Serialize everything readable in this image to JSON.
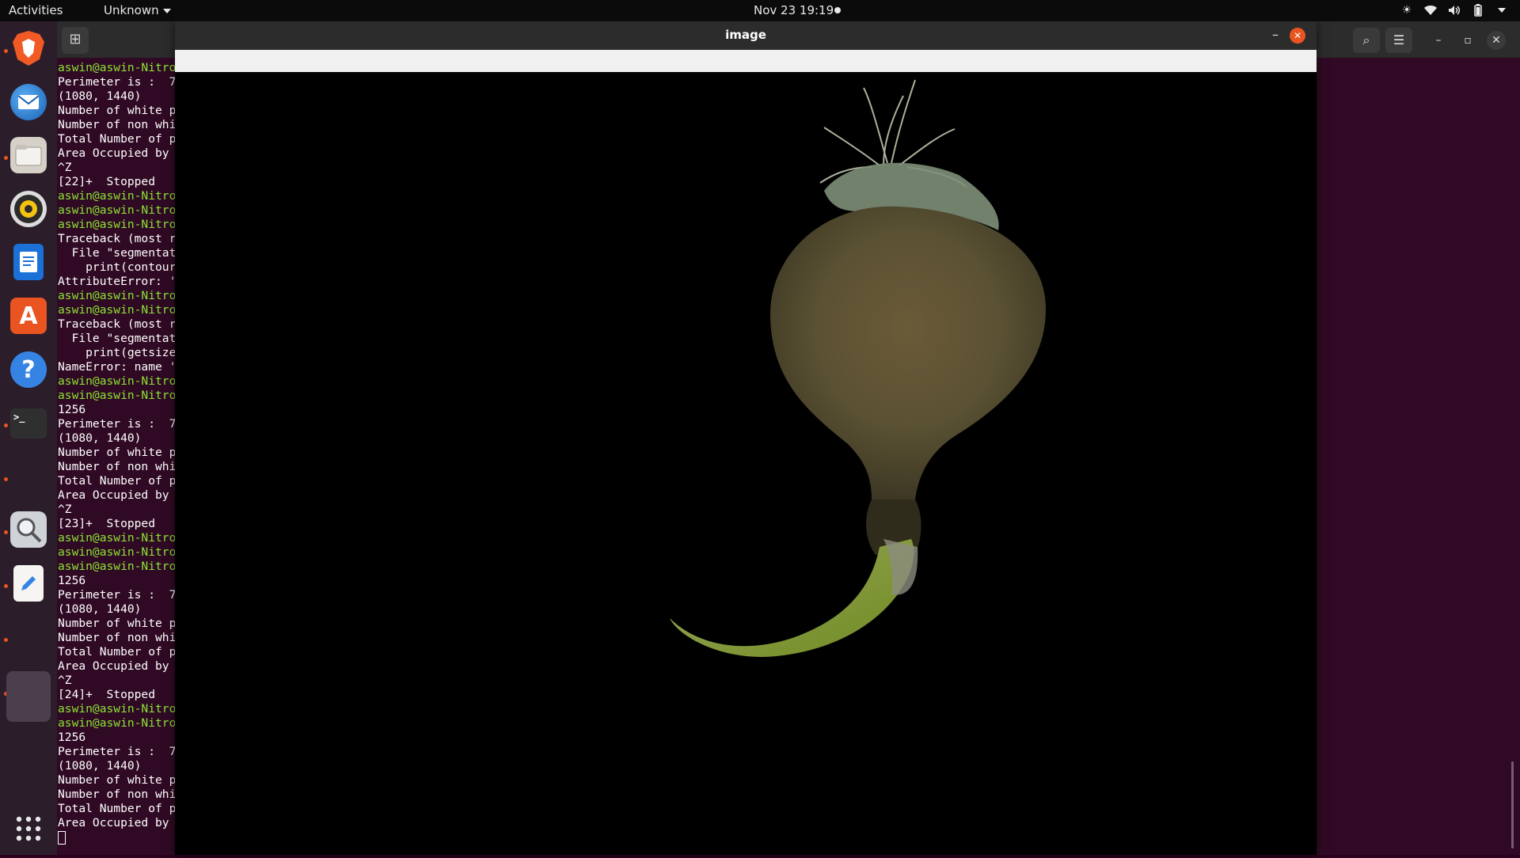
{
  "topbar": {
    "activities": "Activities",
    "app_menu": "Unknown",
    "clock": "Nov 23  19:19"
  },
  "dock": {
    "items": [
      {
        "name": "Brave",
        "icon": "brave-browser-icon"
      },
      {
        "name": "Thunderbird",
        "icon": "thunderbird-mail-icon"
      },
      {
        "name": "Files",
        "icon": "files-folder-icon"
      },
      {
        "name": "Rhythmbox",
        "icon": "rhythmbox-music-icon"
      },
      {
        "name": "LibreOffice Writer",
        "icon": "writer-document-icon"
      },
      {
        "name": "Ubuntu Software",
        "icon": "software-store-icon"
      },
      {
        "name": "Help",
        "icon": "help-icon"
      },
      {
        "name": "Terminal",
        "icon": "terminal-icon"
      },
      {
        "name": "Image Viewer",
        "icon": "magnifier-icon"
      },
      {
        "name": "Text Editor",
        "icon": "text-editor-icon"
      },
      {
        "name": "Image Window",
        "icon": "window-icon"
      }
    ],
    "show_apps_icon": "grid-icon"
  },
  "terminal": {
    "lines": [
      {
        "t": "aswin@aswin-Nitro",
        "p": true
      },
      {
        "t": "Perimeter is :  7",
        "p": false
      },
      {
        "t": "(1080, 1440)",
        "p": false
      },
      {
        "t": "Number of white p",
        "p": false
      },
      {
        "t": "Number of non whi",
        "p": false
      },
      {
        "t": "Total Number of p",
        "p": false
      },
      {
        "t": "Area Occupied by ",
        "p": false
      },
      {
        "t": "^Z",
        "p": false
      },
      {
        "t": "[22]+  Stopped",
        "p": false
      },
      {
        "t": "aswin@aswin-Nitro",
        "p": true
      },
      {
        "t": "aswin@aswin-Nitro",
        "p": true
      },
      {
        "t": "aswin@aswin-Nitro",
        "p": true
      },
      {
        "t": "Traceback (most r",
        "p": false
      },
      {
        "t": "  File \"segmentat",
        "p": false
      },
      {
        "t": "    print(contour",
        "p": false
      },
      {
        "t": "AttributeError: '",
        "p": false
      },
      {
        "t": "aswin@aswin-Nitro",
        "p": true
      },
      {
        "t": "aswin@aswin-Nitro",
        "p": true
      },
      {
        "t": "Traceback (most r",
        "p": false
      },
      {
        "t": "  File \"segmentat",
        "p": false
      },
      {
        "t": "    print(getsize",
        "p": false
      },
      {
        "t": "NameError: name '",
        "p": false
      },
      {
        "t": "aswin@aswin-Nitro",
        "p": true
      },
      {
        "t": "aswin@aswin-Nitro",
        "p": true
      },
      {
        "t": "1256",
        "p": false
      },
      {
        "t": "Perimeter is :  7",
        "p": false
      },
      {
        "t": "(1080, 1440)",
        "p": false
      },
      {
        "t": "Number of white p",
        "p": false
      },
      {
        "t": "Number of non whi",
        "p": false
      },
      {
        "t": "Total Number of p",
        "p": false
      },
      {
        "t": "Area Occupied by ",
        "p": false
      },
      {
        "t": "^Z",
        "p": false
      },
      {
        "t": "[23]+  Stopped",
        "p": false
      },
      {
        "t": "aswin@aswin-Nitro",
        "p": true
      },
      {
        "t": "aswin@aswin-Nitro",
        "p": true
      },
      {
        "t": "aswin@aswin-Nitro",
        "p": true
      },
      {
        "t": "1256",
        "p": false
      },
      {
        "t": "Perimeter is :  7",
        "p": false
      },
      {
        "t": "(1080, 1440)",
        "p": false
      },
      {
        "t": "Number of white p",
        "p": false
      },
      {
        "t": "Number of non whi",
        "p": false
      },
      {
        "t": "Total Number of p",
        "p": false
      },
      {
        "t": "Area Occupied by ",
        "p": false
      },
      {
        "t": "^Z",
        "p": false
      },
      {
        "t": "[24]+  Stopped",
        "p": false
      },
      {
        "t": "aswin@aswin-Nitro",
        "p": true
      },
      {
        "t": "aswin@aswin-Nitro",
        "p": true
      },
      {
        "t": "1256",
        "p": false
      },
      {
        "t": "Perimeter is :  7",
        "p": false
      },
      {
        "t": "(1080, 1440)",
        "p": false
      },
      {
        "t": "Number of white p",
        "p": false
      },
      {
        "t": "Number of non whi",
        "p": false
      },
      {
        "t": "Total Number of p",
        "p": false
      },
      {
        "t": "Area Occupied by ",
        "p": false
      }
    ]
  },
  "image_window": {
    "title": "image"
  },
  "colors": {
    "accent": "#e95420",
    "prompt": "#8ae234",
    "terminal_bg": "#300a24"
  }
}
